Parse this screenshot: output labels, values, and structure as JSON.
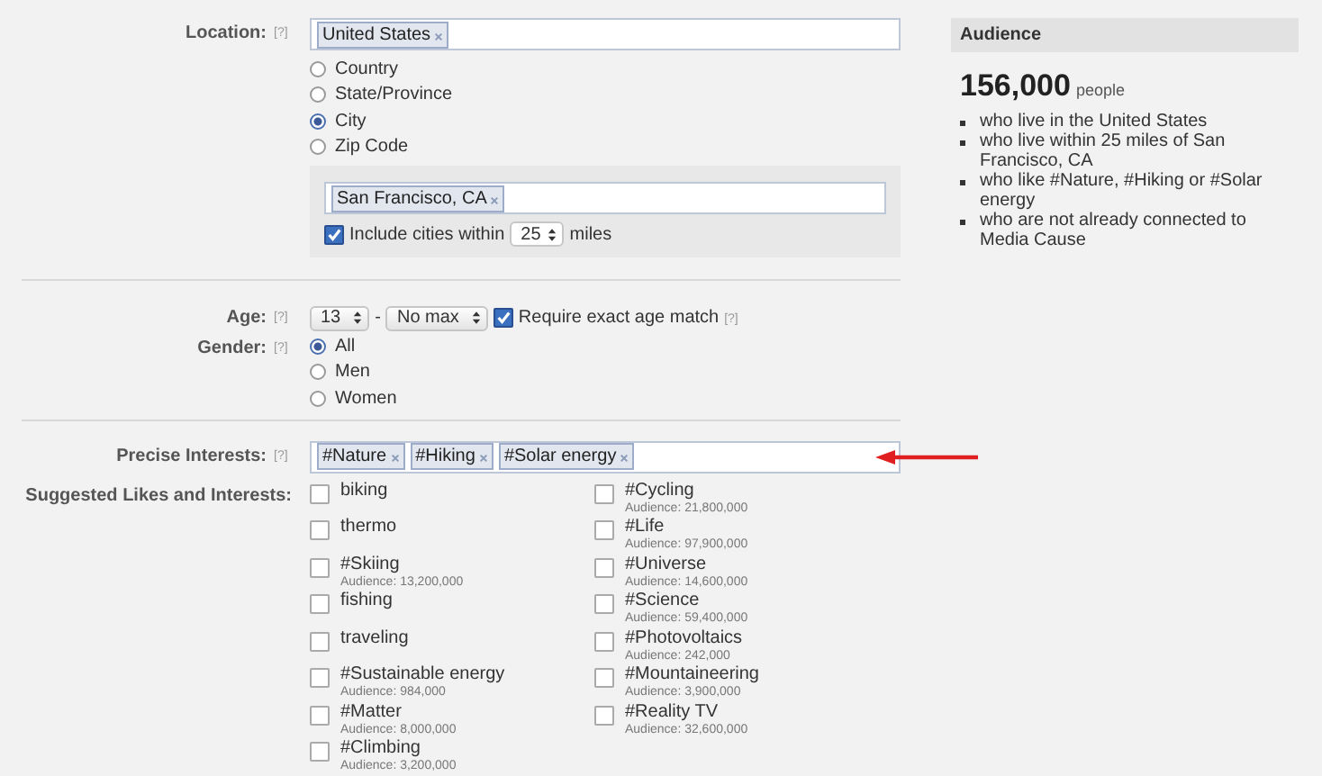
{
  "location": {
    "label": "Location:",
    "help": "[?]",
    "tokens": [
      "United States"
    ],
    "options": [
      {
        "label": "Country",
        "selected": false
      },
      {
        "label": "State/Province",
        "selected": false
      },
      {
        "label": "City",
        "selected": true
      },
      {
        "label": "Zip Code",
        "selected": false
      }
    ],
    "city": {
      "tokens": [
        "San Francisco, CA"
      ],
      "include": {
        "label": "Include cities within",
        "checked": true,
        "radius": "25",
        "unit": "miles"
      }
    }
  },
  "age": {
    "label": "Age:",
    "help": "[?]",
    "min": "13",
    "separator": "-",
    "max": "No max",
    "exact": {
      "label": "Require exact age match",
      "checked": true,
      "help": "[?]"
    }
  },
  "gender": {
    "label": "Gender:",
    "help": "[?]",
    "options": [
      {
        "label": "All",
        "selected": true
      },
      {
        "label": "Men",
        "selected": false
      },
      {
        "label": "Women",
        "selected": false
      }
    ]
  },
  "interests": {
    "label": "Precise Interests:",
    "help": "[?]",
    "tokens": [
      "#Nature",
      "#Hiking",
      "#Solar energy"
    ]
  },
  "suggestions": {
    "label": "Suggested Likes and Interests:",
    "columns": [
      [
        {
          "label": "biking",
          "checked": false
        },
        {
          "label": "thermo",
          "checked": false
        },
        {
          "label": "#Skiing",
          "audience": "Audience: 13,200,000",
          "checked": false
        },
        {
          "label": "fishing",
          "checked": false
        },
        {
          "label": "traveling",
          "checked": false
        },
        {
          "label": "#Sustainable energy",
          "audience": "Audience: 984,000",
          "checked": false
        },
        {
          "label": "#Matter",
          "audience": "Audience: 8,000,000",
          "checked": false
        },
        {
          "label": "#Climbing",
          "audience": "Audience: 3,200,000",
          "checked": false
        }
      ],
      [
        {
          "label": "#Cycling",
          "audience": "Audience: 21,800,000",
          "checked": false
        },
        {
          "label": "#Life",
          "audience": "Audience: 97,900,000",
          "checked": false
        },
        {
          "label": "#Universe",
          "audience": "Audience: 14,600,000",
          "checked": false
        },
        {
          "label": "#Science",
          "audience": "Audience: 59,400,000",
          "checked": false
        },
        {
          "label": "#Photovoltaics",
          "audience": "Audience: 242,000",
          "checked": false
        },
        {
          "label": "#Mountaineering",
          "audience": "Audience: 3,900,000",
          "checked": false
        },
        {
          "label": "#Reality TV",
          "audience": "Audience: 32,600,000",
          "checked": false
        }
      ]
    ]
  },
  "audience": {
    "title": "Audience",
    "count": "156,000",
    "unit": "people",
    "criteria": [
      "who live in the United States",
      "who live within 25 miles of San Francisco, CA",
      "who like #Nature, #Hiking or #Solar energy",
      "who are not already connected to Media Cause"
    ]
  }
}
